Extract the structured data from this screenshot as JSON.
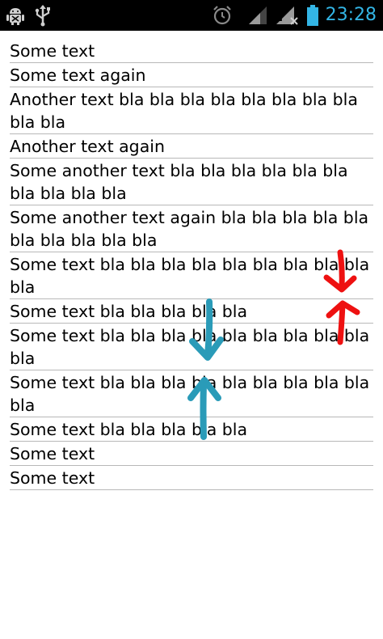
{
  "status_bar": {
    "time": "23:28",
    "icons": [
      "android-debug-icon",
      "usb-icon",
      "alarm-icon",
      "signal-icon",
      "no-data-icon",
      "battery-icon"
    ],
    "clock_color": "#33b5e5",
    "background": "#000000"
  },
  "list": {
    "items": [
      "Some text",
      "Some text again",
      "Another text bla bla bla bla bla bla bla bla bla bla",
      "Another text again",
      "Some another text bla bla bla bla bla bla bla bla bla bla",
      "Some another text again bla bla bla bla bla bla bla bla bla bla",
      "Some text bla bla bla bla bla bla bla bla bla bla",
      "Some text bla bla bla bla bla",
      "Some text bla bla bla bla bla bla bla bla bla bla",
      "Some text bla bla bla bla bla bla bla bla bla bla",
      "Some text bla bla bla bla bla",
      "Some text",
      "Some text"
    ],
    "divider_color": "#b8b8b8"
  },
  "annotations": {
    "red_arrow_color": "#ee1111",
    "teal_arrow_color": "#2a9bb8"
  }
}
